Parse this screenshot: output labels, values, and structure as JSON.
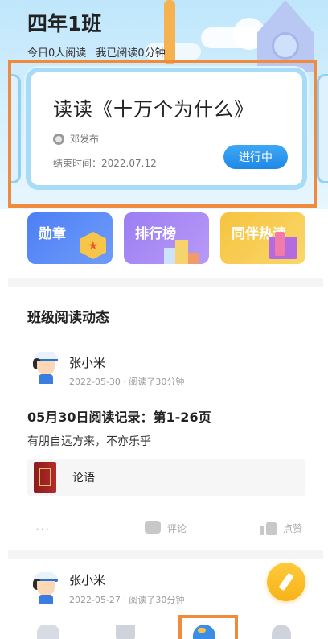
{
  "header": {
    "class_name": "四年1班",
    "stats_today": "今日0人阅读",
    "stats_me": "我已阅读0分钟"
  },
  "task_card": {
    "title": "读读《十万个为什么》",
    "publisher": "邓发布",
    "deadline": "结束时间：2022.07.12",
    "status": "进行中"
  },
  "features": [
    {
      "label": "勋章"
    },
    {
      "label": "排行榜"
    },
    {
      "label": "同伴热读"
    }
  ],
  "activity": {
    "section_title": "班级阅读动态",
    "posts": [
      {
        "user": "张小米",
        "meta": "2022-05-30 · 阅读了30分钟",
        "record_title": "05月30日阅读记录：第1-26页",
        "record_text": "有朋自远方来，不亦乐乎",
        "book": "论语",
        "more": "···",
        "comment": "评论",
        "like": "点赞"
      },
      {
        "user": "张小米",
        "meta": "2022-05-27 · 阅读了30分钟"
      }
    ]
  },
  "colors": {
    "accent_blue": "#1f88e8",
    "highlight_orange": "#f08a3d",
    "fab_yellow": "#f7b318"
  }
}
